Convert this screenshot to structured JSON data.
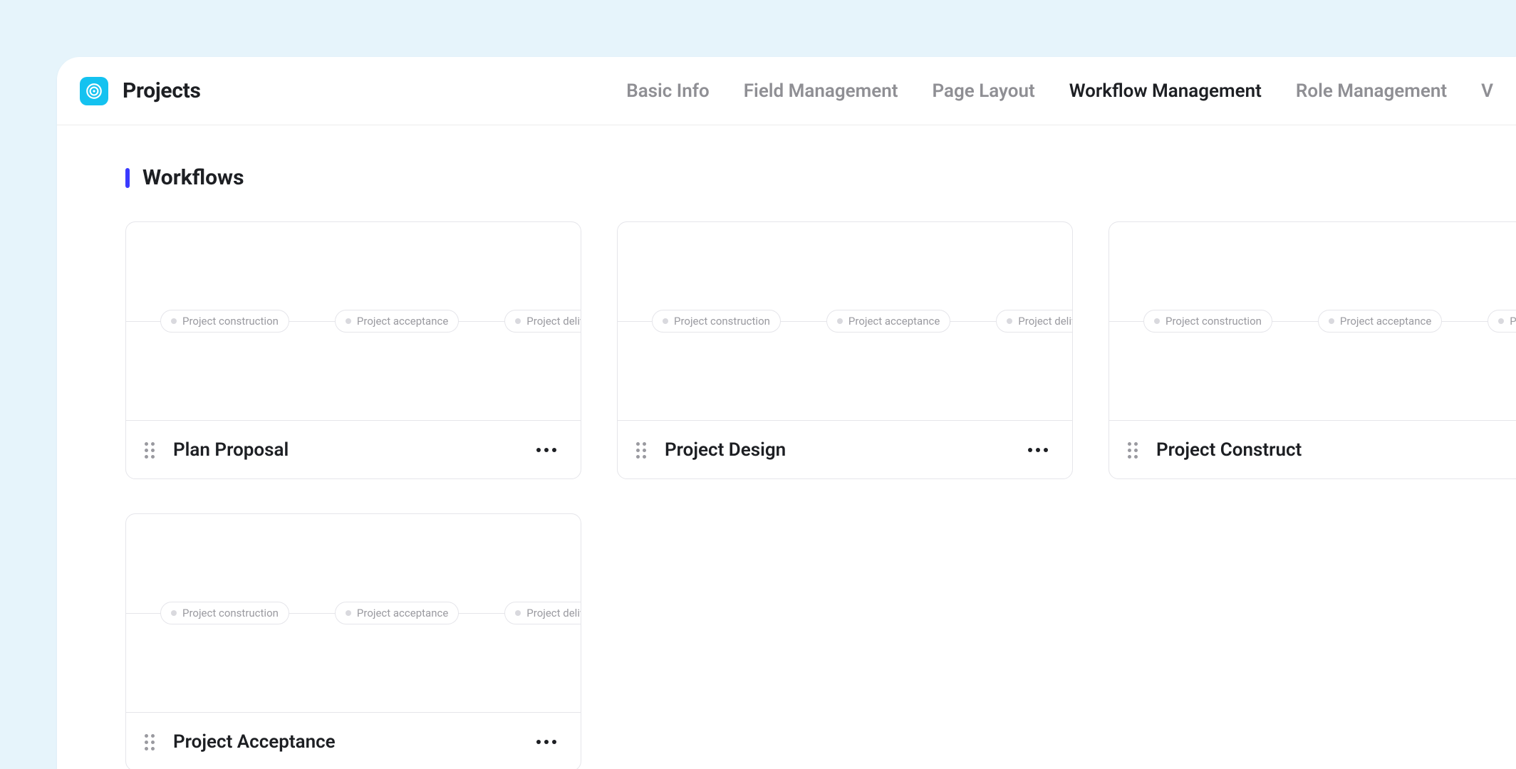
{
  "header": {
    "title": "Projects",
    "tabs": [
      {
        "label": "Basic Info",
        "active": false
      },
      {
        "label": "Field Management",
        "active": false
      },
      {
        "label": "Page Layout",
        "active": false
      },
      {
        "label": "Workflow Management",
        "active": true
      },
      {
        "label": "Role Management",
        "active": false
      },
      {
        "label": "V",
        "active": false
      }
    ]
  },
  "section": {
    "title": "Workflows"
  },
  "pill_stages": [
    "Project construction",
    "Project acceptance",
    "Project delivery"
  ],
  "workflows": [
    {
      "title": "Plan Proposal"
    },
    {
      "title": "Project Design"
    },
    {
      "title": "Project Construct"
    },
    {
      "title": "Project Acceptance"
    }
  ],
  "colors": {
    "page_bg": "#e6f4fb",
    "accent": "#3a3aff",
    "icon_bg": "#14c2f0",
    "text": "#1d1f23",
    "muted": "#8f8f94",
    "border": "#e5e5ea"
  }
}
